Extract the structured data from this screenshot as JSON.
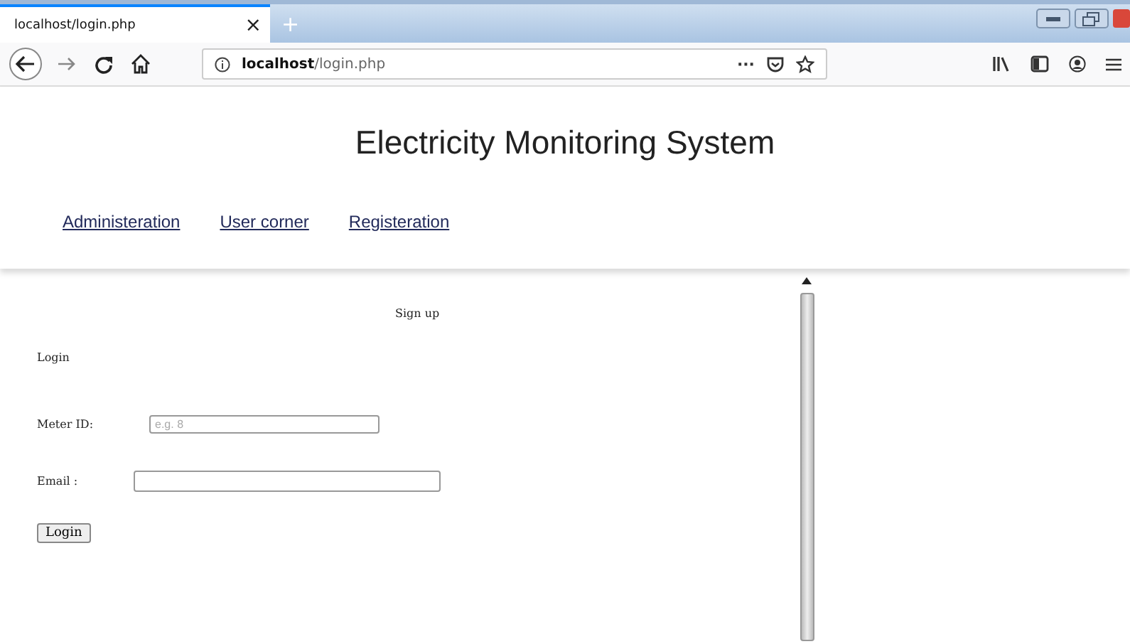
{
  "browser": {
    "tab_title": "localhost/login.php",
    "tab_close": "×",
    "new_tab": "+",
    "url_host": "localhost",
    "url_path": "/login.php",
    "page_actions": "···"
  },
  "site": {
    "title": "Electricity Monitoring System",
    "nav": [
      {
        "label": "Administeration"
      },
      {
        "label": "User corner"
      },
      {
        "label": "Registeration"
      }
    ]
  },
  "form": {
    "heading": "Sign up",
    "subheading": "Login",
    "fields": [
      {
        "label": "Meter ID:",
        "placeholder": "e.g. 8"
      },
      {
        "label": "Email :"
      }
    ],
    "submit": "Login"
  }
}
